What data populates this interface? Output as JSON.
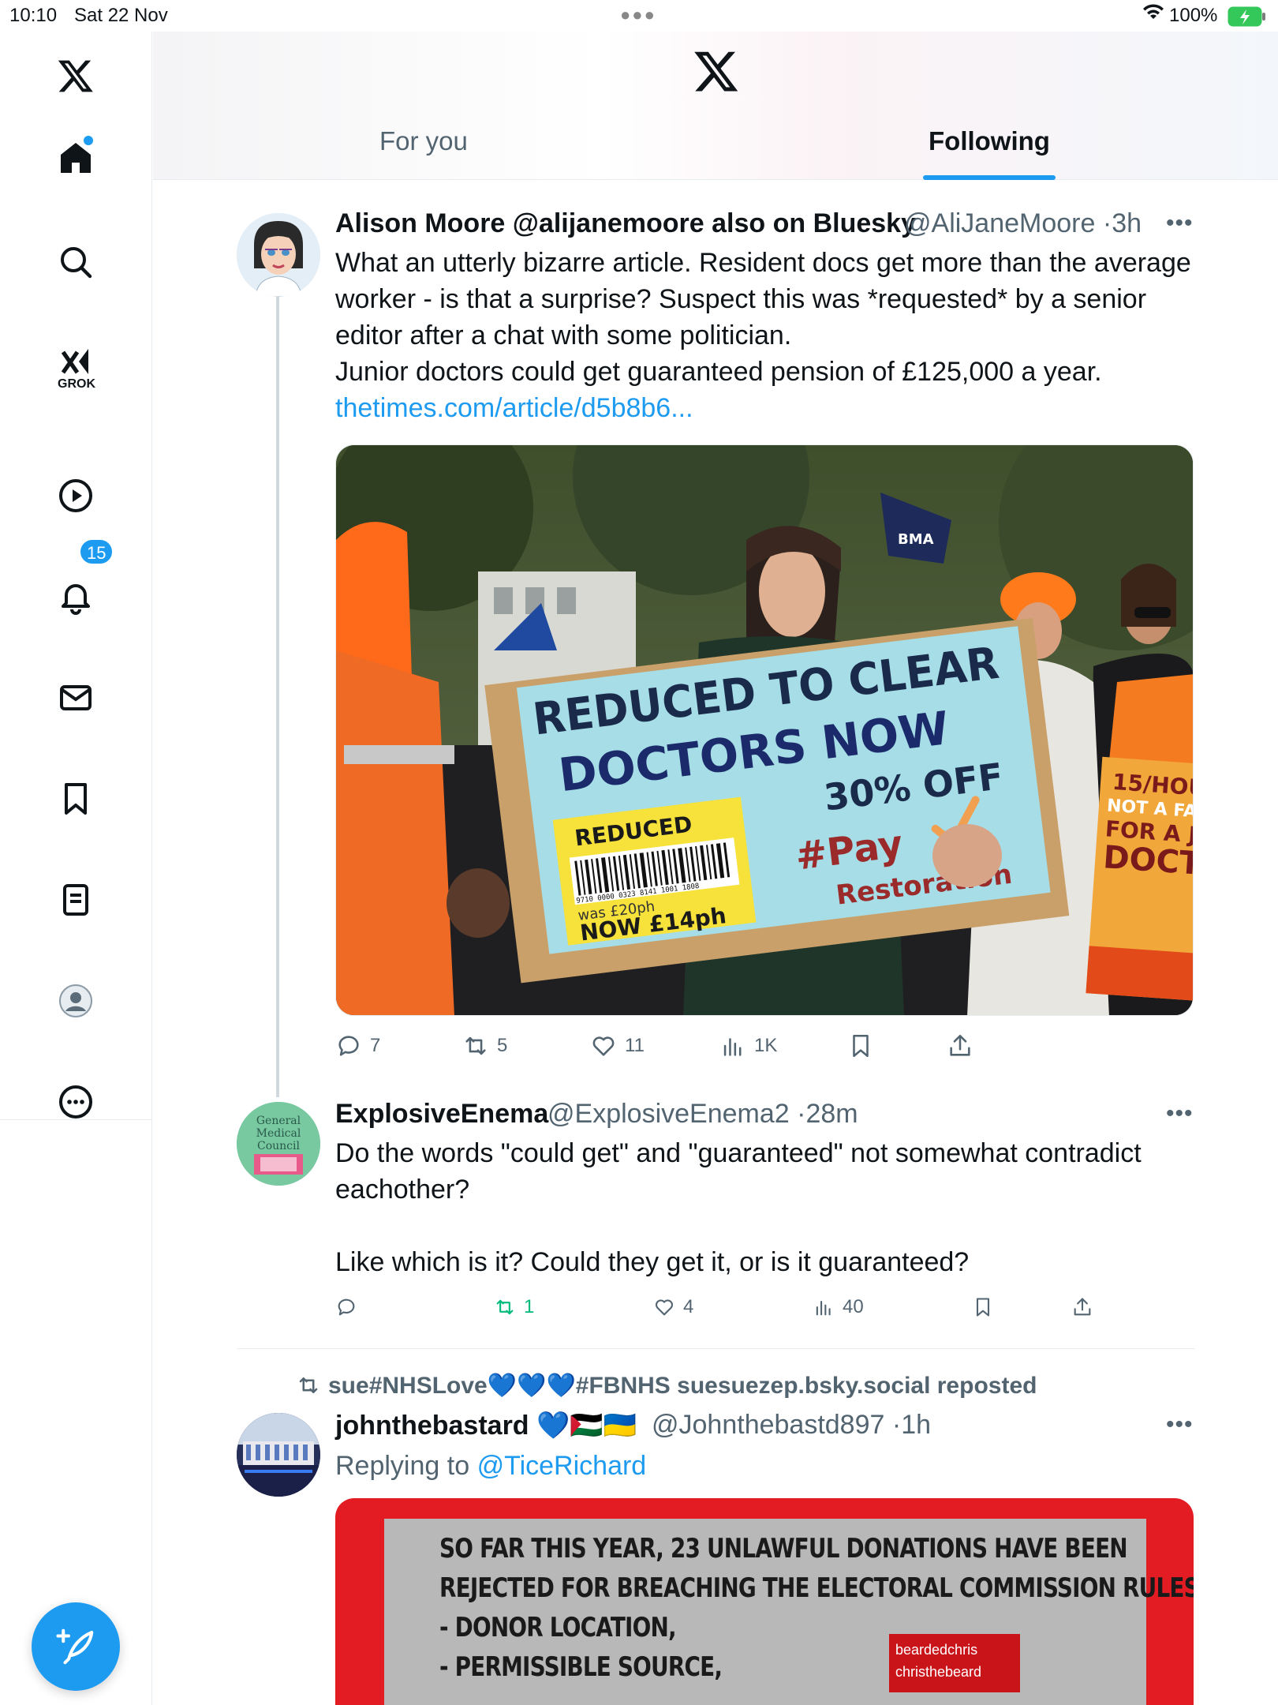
{
  "status_bar": {
    "time": "10:10",
    "date": "Sat 22 Nov",
    "battery": "100%"
  },
  "sidebar": {
    "items": [
      {
        "name": "home",
        "label": "Home"
      },
      {
        "name": "search",
        "label": "Search"
      },
      {
        "name": "grok",
        "label": "GROK"
      },
      {
        "name": "videos",
        "label": "Videos"
      },
      {
        "name": "notifications",
        "label": "Notifications",
        "badge": "15"
      },
      {
        "name": "messages",
        "label": "Messages"
      },
      {
        "name": "bookmarks",
        "label": "Bookmarks"
      },
      {
        "name": "lists",
        "label": "Lists"
      },
      {
        "name": "profile",
        "label": "Profile"
      },
      {
        "name": "more",
        "label": "More"
      }
    ]
  },
  "header": {
    "tabs": [
      {
        "label": "For you",
        "active": false
      },
      {
        "label": "Following",
        "active": true
      }
    ]
  },
  "tweets": [
    {
      "name": "Alison Moore @alijanemoore also on Bluesky",
      "handle": "@AliJaneMoore",
      "time": "3h",
      "text": "What an utterly bizarre article. Resident docs get more than the average\nworker - is that a surprise? Suspect this was *requested* by a senior\neditor after a chat with some politician.\nJunior doctors could get guaranteed pension of £125,000 a year.",
      "link": "thetimes.com/article/d5b8b6...",
      "image_sign": {
        "line1": "REDUCED TO CLEAR",
        "line2": "DOCTORS NOW",
        "line3": "30% OFF",
        "sticker_top": "REDUCED",
        "barcode_number": "9710 0000 0323 8141 1001 1808",
        "was": "was £20ph",
        "now": "NOW £14ph",
        "hashtag": "#Pay",
        "hashtag2": "Restoration",
        "flag": "BMA",
        "side_sign": "15/HOU\nNOT A FAIR\nFOR A JU\nDOCT"
      },
      "replies": "7",
      "reposts": "5",
      "likes": "11",
      "views": "1K"
    },
    {
      "name": "ExplosiveEnema",
      "handle": "@ExplosiveEnema2",
      "time": "28m",
      "avatar_text": "General\nMedical\nCouncil",
      "text": "Do the words \"could get\" and \"guaranteed\" not somewhat contradict\neachother?\n\nLike which is it? Could they get it, or is it guaranteed?",
      "replies": "",
      "reposts": "1",
      "likes": "4",
      "views": "40"
    },
    {
      "repost_by": "sue#NHSLove💙💙💙#FBNHS suesuezep.bsky.social reposted",
      "name": "johnthebastard 💙🇵🇸🇺🇦",
      "handle": "@Johnthebastd897",
      "time": "1h",
      "replying_to_label": "Replying to",
      "replying_to": "@TiceRichard",
      "image_lines": [
        "SO FAR THIS YEAR, 23 UNLAWFUL DONATIONS HAVE BEEN",
        "REJECTED FOR BREACHING THE ELECTORAL COMMISSION RULES ON",
        "- DONOR LOCATION,",
        "- PERMISSIBLE SOURCE,"
      ],
      "image_social": [
        "beardedchris",
        "christhebeard"
      ]
    }
  ],
  "colors": {
    "accent": "#1d9bf0",
    "repost_green": "#00ba7c",
    "secondary_text": "#536471"
  }
}
